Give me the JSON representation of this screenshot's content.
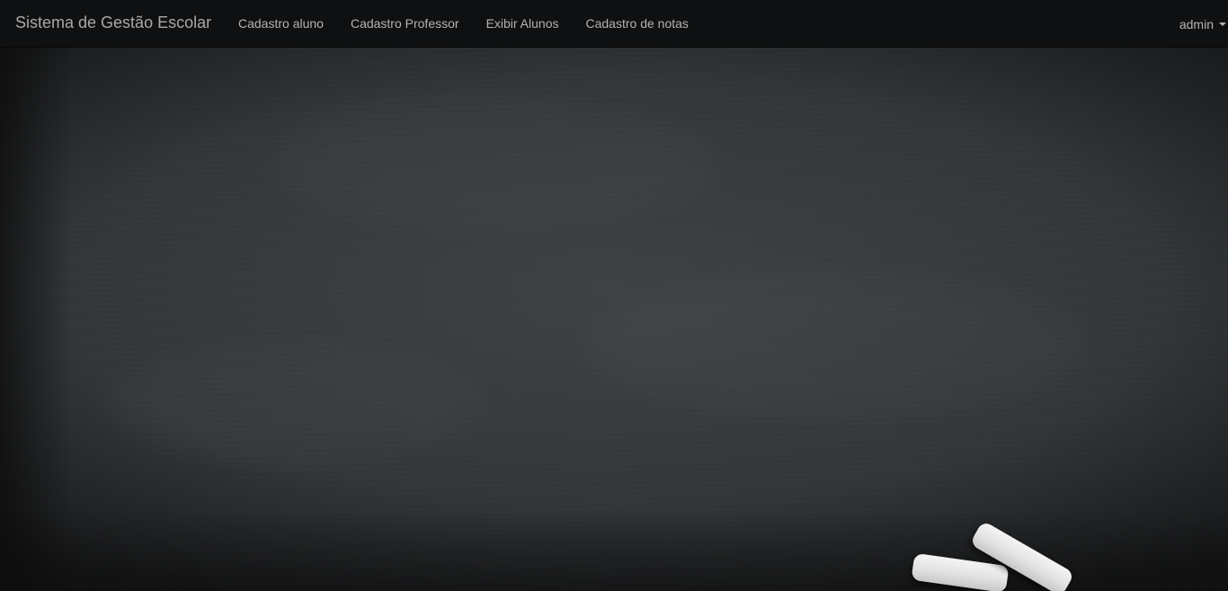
{
  "navbar": {
    "brand": "Sistema de Gestão Escolar",
    "links": [
      {
        "label": "Cadastro aluno"
      },
      {
        "label": "Cadastro Professor"
      },
      {
        "label": "Exibir Alunos"
      },
      {
        "label": "Cadastro de notas"
      }
    ],
    "user": {
      "label": "admin",
      "icon": "caret-down-icon"
    }
  },
  "colors": {
    "navbar_bg": "#0f1011",
    "nav_text": "#b3b3b3",
    "board": "#35393c",
    "chalk": "#f0f0f0"
  }
}
